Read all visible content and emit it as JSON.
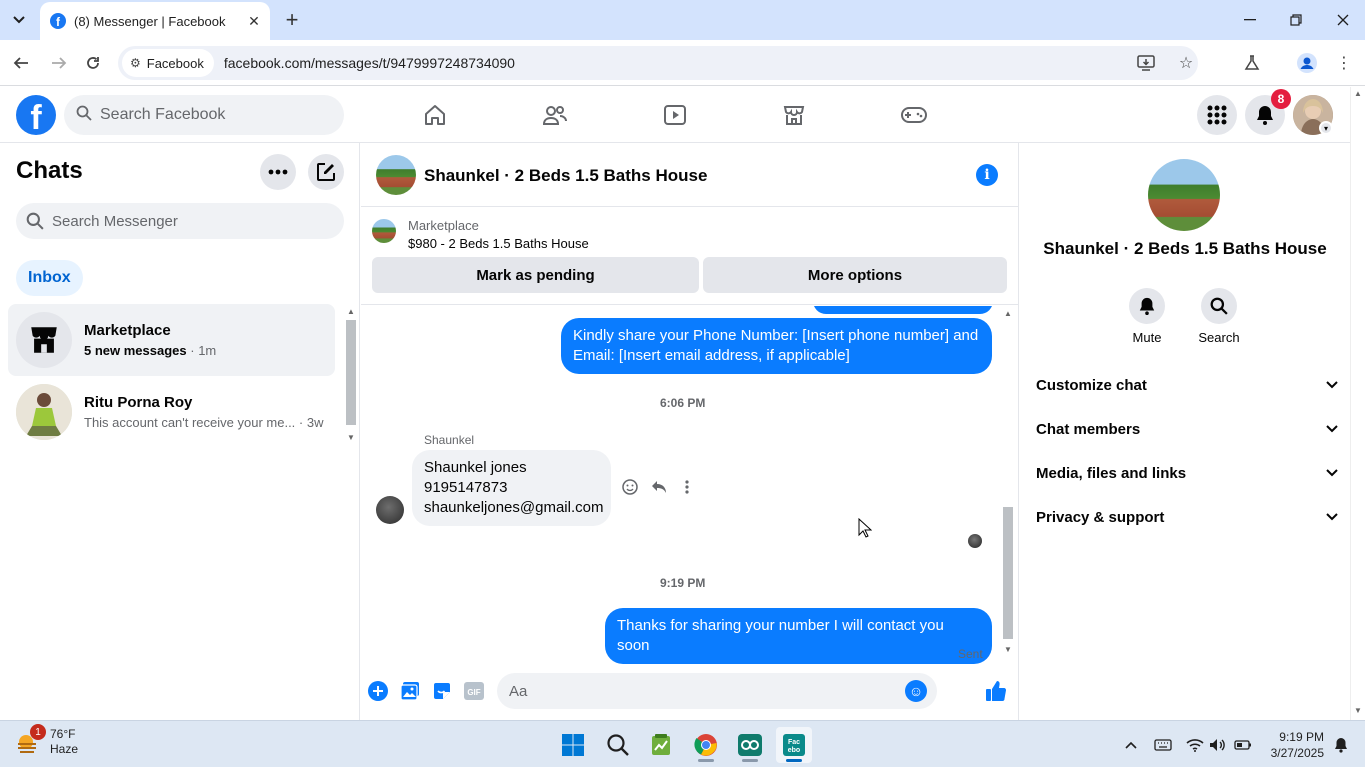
{
  "browser": {
    "tab_title": "(8) Messenger | Facebook",
    "site_chip": "Facebook",
    "url": "facebook.com/messages/t/9479997248734090"
  },
  "fb_header": {
    "search_placeholder": "Search Facebook",
    "notification_count": "8"
  },
  "chats": {
    "title": "Chats",
    "search_placeholder": "Search Messenger",
    "inbox_label": "Inbox",
    "items": [
      {
        "name": "Marketplace",
        "preview": "5 new messages",
        "time": "· 1m"
      },
      {
        "name": "Ritu Porna Roy",
        "preview": "This account can't receive your me...",
        "time": " · 3w"
      }
    ]
  },
  "conversation": {
    "title": "Shaunkel · 2 Beds 1.5 Baths House",
    "marketplace_label": "Marketplace",
    "listing": "$980 - 2 Beds 1.5 Baths House",
    "mark_pending": "Mark as pending",
    "more_options": "More options",
    "out_msg_1": "Kindly share your Phone Number: [Insert phone number] and Email: [Insert email address, if applicable]",
    "time_1": "6:06 PM",
    "sender": "Shaunkel",
    "in_msg_line1": "Shaunkel jones",
    "in_msg_line2": "9195147873",
    "in_msg_line3": "shaunkeljones@gmail.com",
    "time_2": "9:19 PM",
    "out_msg_2": "Thanks for sharing your number I will contact you soon",
    "status": "Sent",
    "composer_placeholder": "Aa"
  },
  "details": {
    "name": "Shaunkel · 2 Beds 1.5 Baths House",
    "mute": "Mute",
    "search": "Search",
    "rows": [
      "Customize chat",
      "Chat members",
      "Media, files and links",
      "Privacy & support"
    ]
  },
  "taskbar": {
    "temp": "76°F",
    "condition": "Haze",
    "weather_badge": "1",
    "time": "9:19 PM",
    "date": "3/27/2025"
  },
  "colors": {
    "fb_blue": "#1877f2",
    "messenger_blue": "#0a7cff",
    "badge_red": "#e41e3f"
  }
}
